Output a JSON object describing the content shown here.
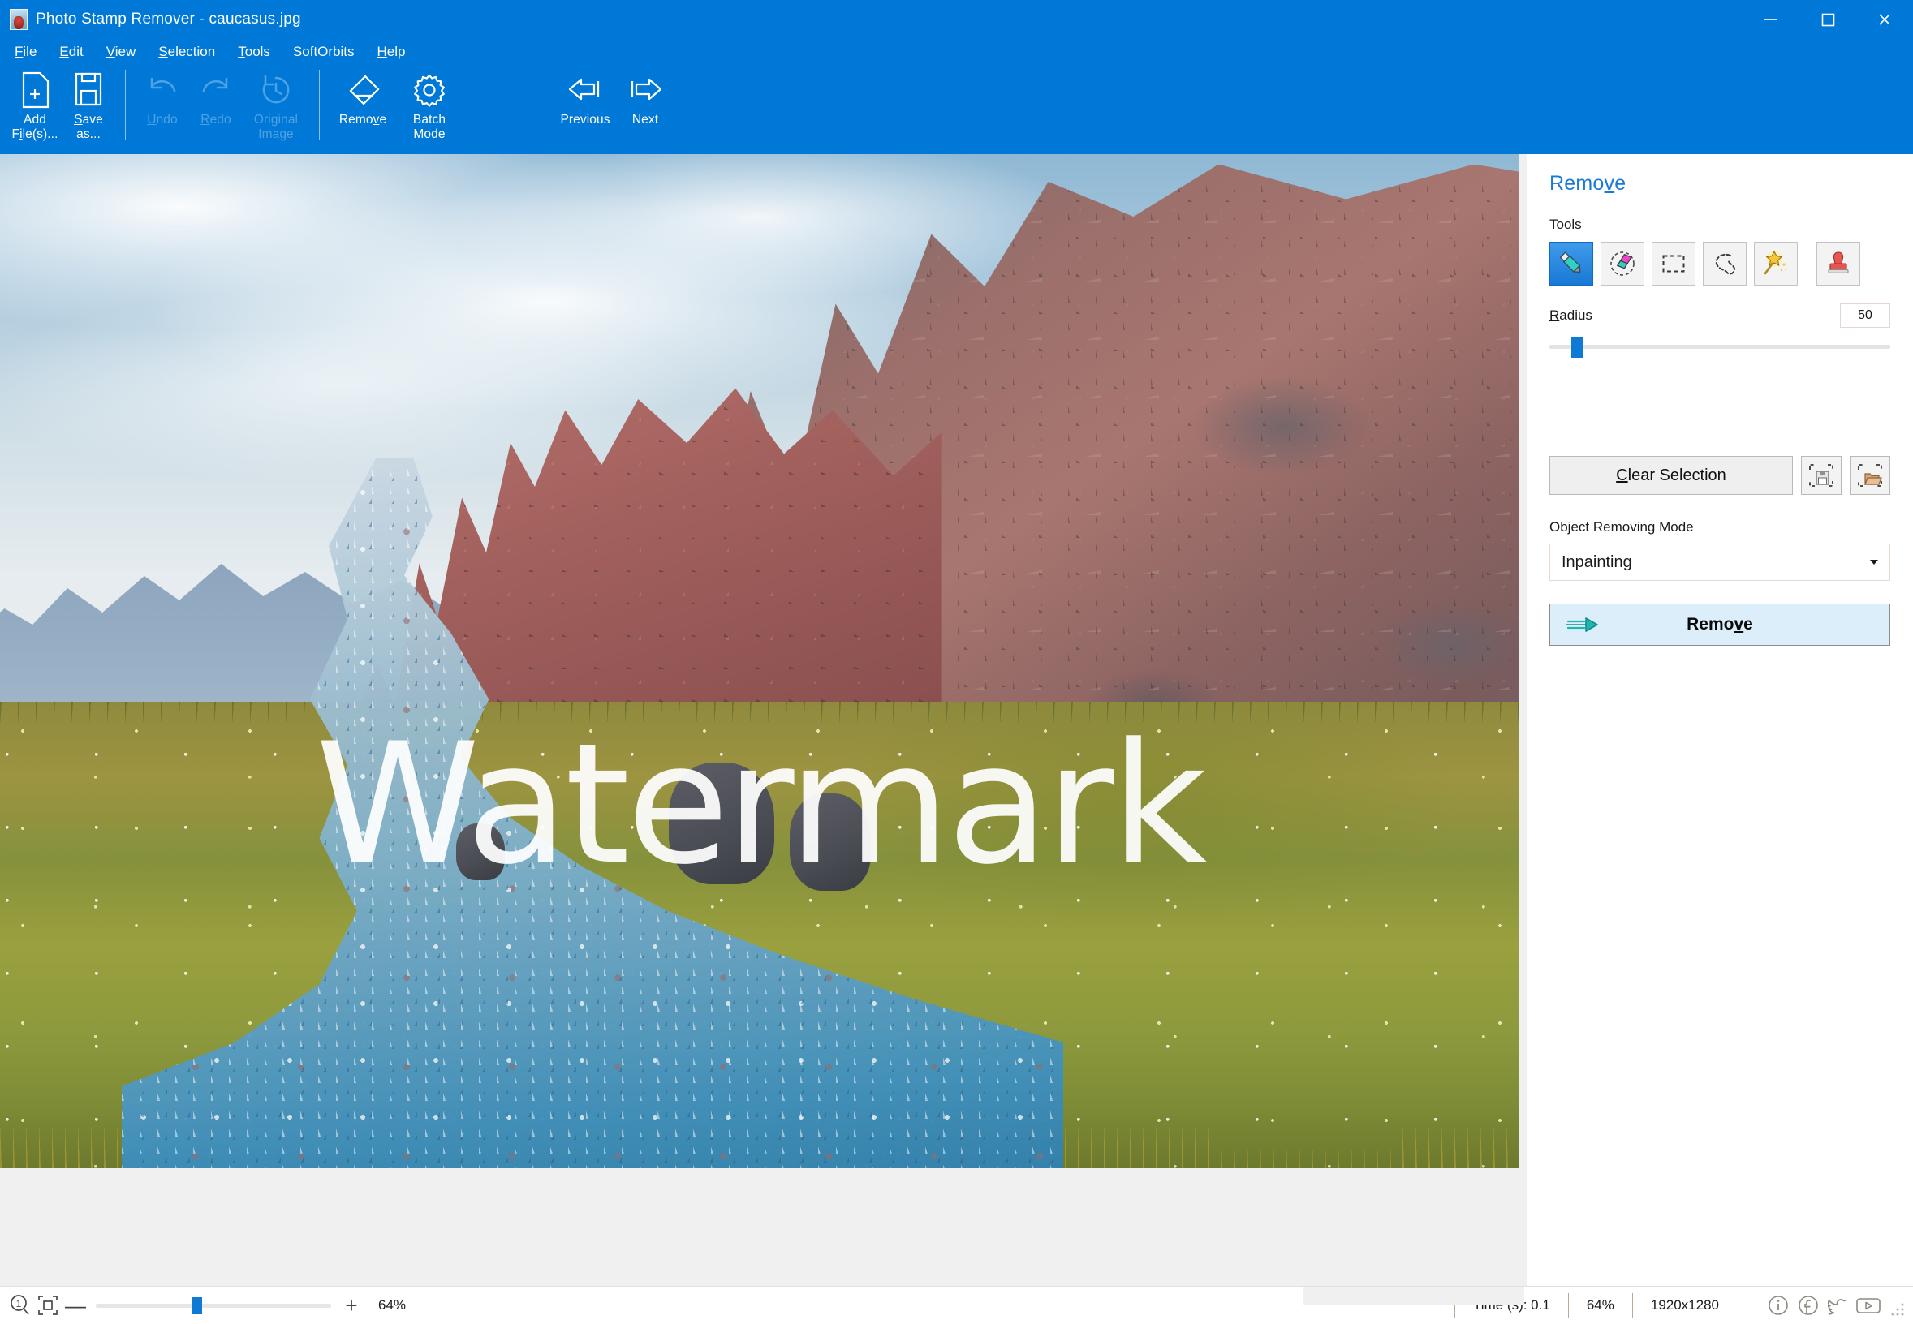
{
  "window": {
    "title": "Photo Stamp Remover - caucasus.jpg",
    "app_icon": "photo-icon",
    "minimize_label": "Minimize",
    "maximize_label": "Maximize",
    "close_label": "Close"
  },
  "menubar": {
    "items": [
      {
        "pre": "",
        "acc": "F",
        "post": "ile",
        "name": "file"
      },
      {
        "pre": "",
        "acc": "E",
        "post": "dit",
        "name": "edit"
      },
      {
        "pre": "",
        "acc": "V",
        "post": "iew",
        "name": "view"
      },
      {
        "pre": "",
        "acc": "S",
        "post": "election",
        "name": "selection"
      },
      {
        "pre": "",
        "acc": "T",
        "post": "ools",
        "name": "tools"
      },
      {
        "pre": "SoftOrbits",
        "acc": "",
        "post": "",
        "name": "softorbits"
      },
      {
        "pre": "",
        "acc": "H",
        "post": "elp",
        "name": "help"
      }
    ]
  },
  "toolbar": {
    "add_files": {
      "line1": "Add",
      "line2_pre": "F",
      "line2_acc": "i",
      "line2_post": "le(s)..."
    },
    "save_as": {
      "line1_acc": "S",
      "line1_post": "ave",
      "line2": "as..."
    },
    "undo": {
      "acc": "U",
      "post": "ndo"
    },
    "redo": {
      "acc": "R",
      "post": "edo"
    },
    "original_image": {
      "line1": "Original",
      "line2": "Image"
    },
    "remove": {
      "pre": "Remo",
      "acc": "v",
      "post": "e"
    },
    "batch_mode": {
      "line1": "Batch",
      "line2": "Mode"
    },
    "previous": "Previous",
    "next": "Next"
  },
  "panel": {
    "title_pre": "Remo",
    "title_acc": "v",
    "title_post": "e",
    "tools_label": "Tools",
    "tools": [
      {
        "name": "marker-tool",
        "label": "Marker",
        "active": true
      },
      {
        "name": "eraser-tool",
        "label": "Eraser",
        "active": false
      },
      {
        "name": "rectangle-select-tool",
        "label": "Rectangle Selection",
        "active": false
      },
      {
        "name": "lasso-select-tool",
        "label": "Lasso Selection",
        "active": false
      },
      {
        "name": "magic-wand-tool",
        "label": "Magic Wand",
        "active": false
      },
      {
        "name": "stamp-tool",
        "label": "Stamp",
        "active": false
      }
    ],
    "radius_label_acc": "R",
    "radius_label_post": "adius",
    "radius_value": "50",
    "radius_slider_percent": 6.5,
    "clear_selection": {
      "acc": "C",
      "post": "lear Selection"
    },
    "save_selection_label": "Save Selection",
    "load_selection_label": "Load Selection",
    "mode_label": "Object Removing Mode",
    "mode_value": "Inpainting",
    "mode_options": [
      "Inpainting"
    ],
    "remove_button": {
      "pre": "Remo",
      "acc": "v",
      "post": "e"
    }
  },
  "canvas": {
    "watermark_text": "Watermark",
    "image_file": "caucasus.jpg"
  },
  "statusbar": {
    "zoom_reset_icon": "zoom-1to1-icon",
    "fit_icon": "fit-to-window-icon",
    "zoom_out": "—",
    "zoom_in": "+",
    "zoom_percent_left": "64%",
    "zoom_slider_percent": 41,
    "time_label": "Time (s): 0.1",
    "zoom_percent_right": "64%",
    "dimensions": "1920x1280",
    "social": [
      {
        "name": "info-icon",
        "label": "Info"
      },
      {
        "name": "facebook-icon",
        "label": "Facebook"
      },
      {
        "name": "twitter-icon",
        "label": "Twitter"
      },
      {
        "name": "youtube-icon",
        "label": "YouTube"
      }
    ]
  },
  "colors": {
    "titlebar": "#0078d7",
    "accent": "#1a7bd4",
    "slider": "#0f7ad6",
    "remove_button_bg": "#ddeefb"
  }
}
